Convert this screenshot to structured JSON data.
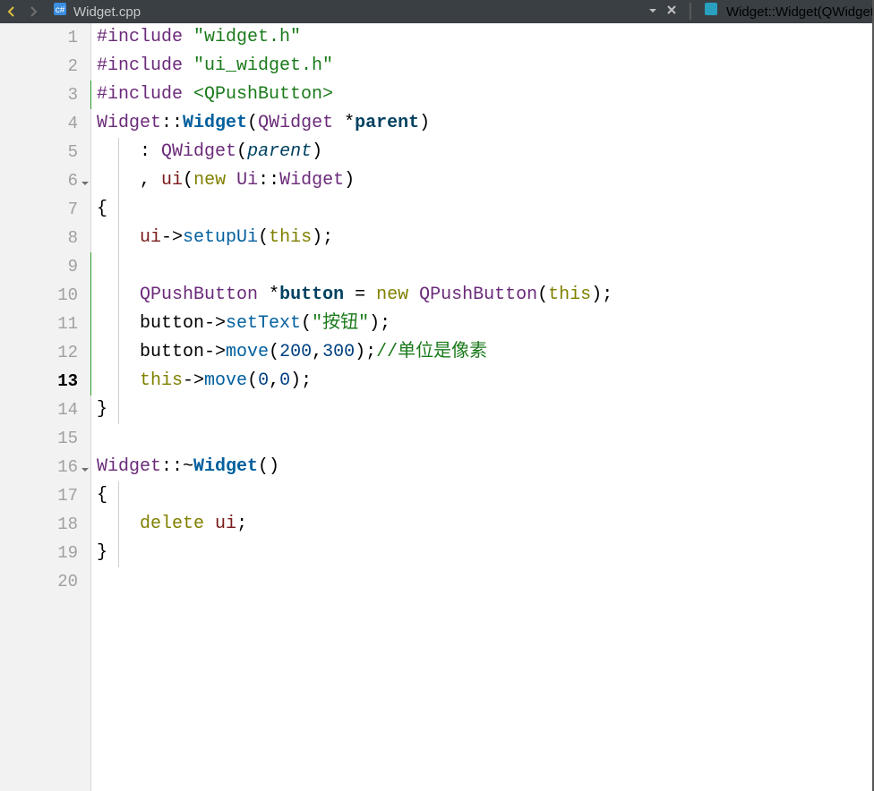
{
  "tabs": {
    "file_name": "Widget.cpp",
    "breadcrumb": "Widget::Widget(QWidget"
  },
  "editor": {
    "current_line": 13,
    "total_lines": 20,
    "fold_markers": [
      6,
      16
    ],
    "modified_ranges": [
      [
        3,
        3
      ],
      [
        9,
        13
      ]
    ],
    "lines": [
      {
        "n": 1,
        "t": [
          [
            "c-pre",
            "#include"
          ],
          [
            "",
            ""
          ],
          [
            "c-pun",
            " "
          ],
          [
            "c-str",
            "\"widget.h\""
          ]
        ]
      },
      {
        "n": 2,
        "t": [
          [
            "c-pre",
            "#include"
          ],
          [
            "c-pun",
            " "
          ],
          [
            "c-str",
            "\"ui_widget.h\""
          ]
        ]
      },
      {
        "n": 3,
        "t": [
          [
            "c-pre",
            "#include"
          ],
          [
            "c-pun",
            " "
          ],
          [
            "c-inc",
            "<QPushButton>"
          ]
        ]
      },
      {
        "n": 4,
        "t": [
          [
            "c-ident",
            "Widget"
          ],
          [
            "c-pun",
            "::"
          ],
          [
            "c-class",
            "Widget"
          ],
          [
            "c-pun",
            "("
          ],
          [
            "c-ident",
            "QWidget"
          ],
          [
            "c-pun",
            " *"
          ],
          [
            "c-param",
            "parent"
          ],
          [
            "c-pun",
            ")"
          ]
        ]
      },
      {
        "n": 5,
        "t": [
          [
            "",
            "    "
          ],
          [
            "c-pun",
            ": "
          ],
          [
            "c-ident",
            "QWidget"
          ],
          [
            "c-pun",
            "("
          ],
          [
            "c-it",
            "parent"
          ],
          [
            "c-pun",
            ")"
          ]
        ]
      },
      {
        "n": 6,
        "t": [
          [
            "",
            "    "
          ],
          [
            "c-pun",
            ", "
          ],
          [
            "c-field",
            "ui"
          ],
          [
            "c-pun",
            "("
          ],
          [
            "c-kw",
            "new"
          ],
          [
            "c-pun",
            " "
          ],
          [
            "c-ident",
            "Ui"
          ],
          [
            "c-pun",
            "::"
          ],
          [
            "c-ident",
            "Widget"
          ],
          [
            "c-pun",
            ")"
          ]
        ]
      },
      {
        "n": 7,
        "t": [
          [
            "c-pun",
            "{"
          ]
        ]
      },
      {
        "n": 8,
        "t": [
          [
            "",
            "    "
          ],
          [
            "c-field",
            "ui"
          ],
          [
            "c-pun",
            "->"
          ],
          [
            "c-func",
            "setupUi"
          ],
          [
            "c-pun",
            "("
          ],
          [
            "c-kw",
            "this"
          ],
          [
            "c-pun",
            ");"
          ]
        ]
      },
      {
        "n": 9,
        "t": [
          [
            "",
            ""
          ]
        ]
      },
      {
        "n": 10,
        "t": [
          [
            "",
            "    "
          ],
          [
            "c-ident",
            "QPushButton"
          ],
          [
            "c-pun",
            " *"
          ],
          [
            "c-param",
            "button"
          ],
          [
            "c-pun",
            " = "
          ],
          [
            "c-kw",
            "new"
          ],
          [
            "c-pun",
            " "
          ],
          [
            "c-ident",
            "QPushButton"
          ],
          [
            "c-pun",
            "("
          ],
          [
            "c-kw",
            "this"
          ],
          [
            "c-pun",
            ");"
          ]
        ]
      },
      {
        "n": 11,
        "t": [
          [
            "",
            "    "
          ],
          [
            "c-pun",
            "button->"
          ],
          [
            "c-func",
            "setText"
          ],
          [
            "c-pun",
            "("
          ],
          [
            "c-str",
            "\"按钮\""
          ],
          [
            "c-pun",
            ");"
          ]
        ]
      },
      {
        "n": 12,
        "t": [
          [
            "",
            "    "
          ],
          [
            "c-pun",
            "button->"
          ],
          [
            "c-func",
            "move"
          ],
          [
            "c-pun",
            "("
          ],
          [
            "c-num",
            "200"
          ],
          [
            "c-pun",
            ","
          ],
          [
            "c-num",
            "300"
          ],
          [
            "c-pun",
            ");"
          ],
          [
            "c-cmt",
            "//单位是像素"
          ]
        ]
      },
      {
        "n": 13,
        "t": [
          [
            "",
            "    "
          ],
          [
            "c-kw",
            "this"
          ],
          [
            "c-pun",
            "->"
          ],
          [
            "c-func",
            "move"
          ],
          [
            "c-pun",
            "("
          ],
          [
            "c-num",
            "0"
          ],
          [
            "c-pun",
            ","
          ],
          [
            "c-num",
            "0"
          ],
          [
            "c-pun",
            ");"
          ]
        ]
      },
      {
        "n": 14,
        "t": [
          [
            "c-pun",
            "}"
          ]
        ]
      },
      {
        "n": 15,
        "t": [
          [
            "",
            ""
          ]
        ]
      },
      {
        "n": 16,
        "t": [
          [
            "c-ident",
            "Widget"
          ],
          [
            "c-pun",
            "::~"
          ],
          [
            "c-class",
            "Widget"
          ],
          [
            "c-pun",
            "()"
          ]
        ]
      },
      {
        "n": 17,
        "t": [
          [
            "c-pun",
            "{"
          ]
        ]
      },
      {
        "n": 18,
        "t": [
          [
            "",
            "    "
          ],
          [
            "c-kw",
            "delete"
          ],
          [
            "c-pun",
            " "
          ],
          [
            "c-field",
            "ui"
          ],
          [
            "c-pun",
            ";"
          ]
        ]
      },
      {
        "n": 19,
        "t": [
          [
            "c-pun",
            "}"
          ]
        ]
      },
      {
        "n": 20,
        "t": [
          [
            "",
            ""
          ]
        ]
      }
    ]
  }
}
